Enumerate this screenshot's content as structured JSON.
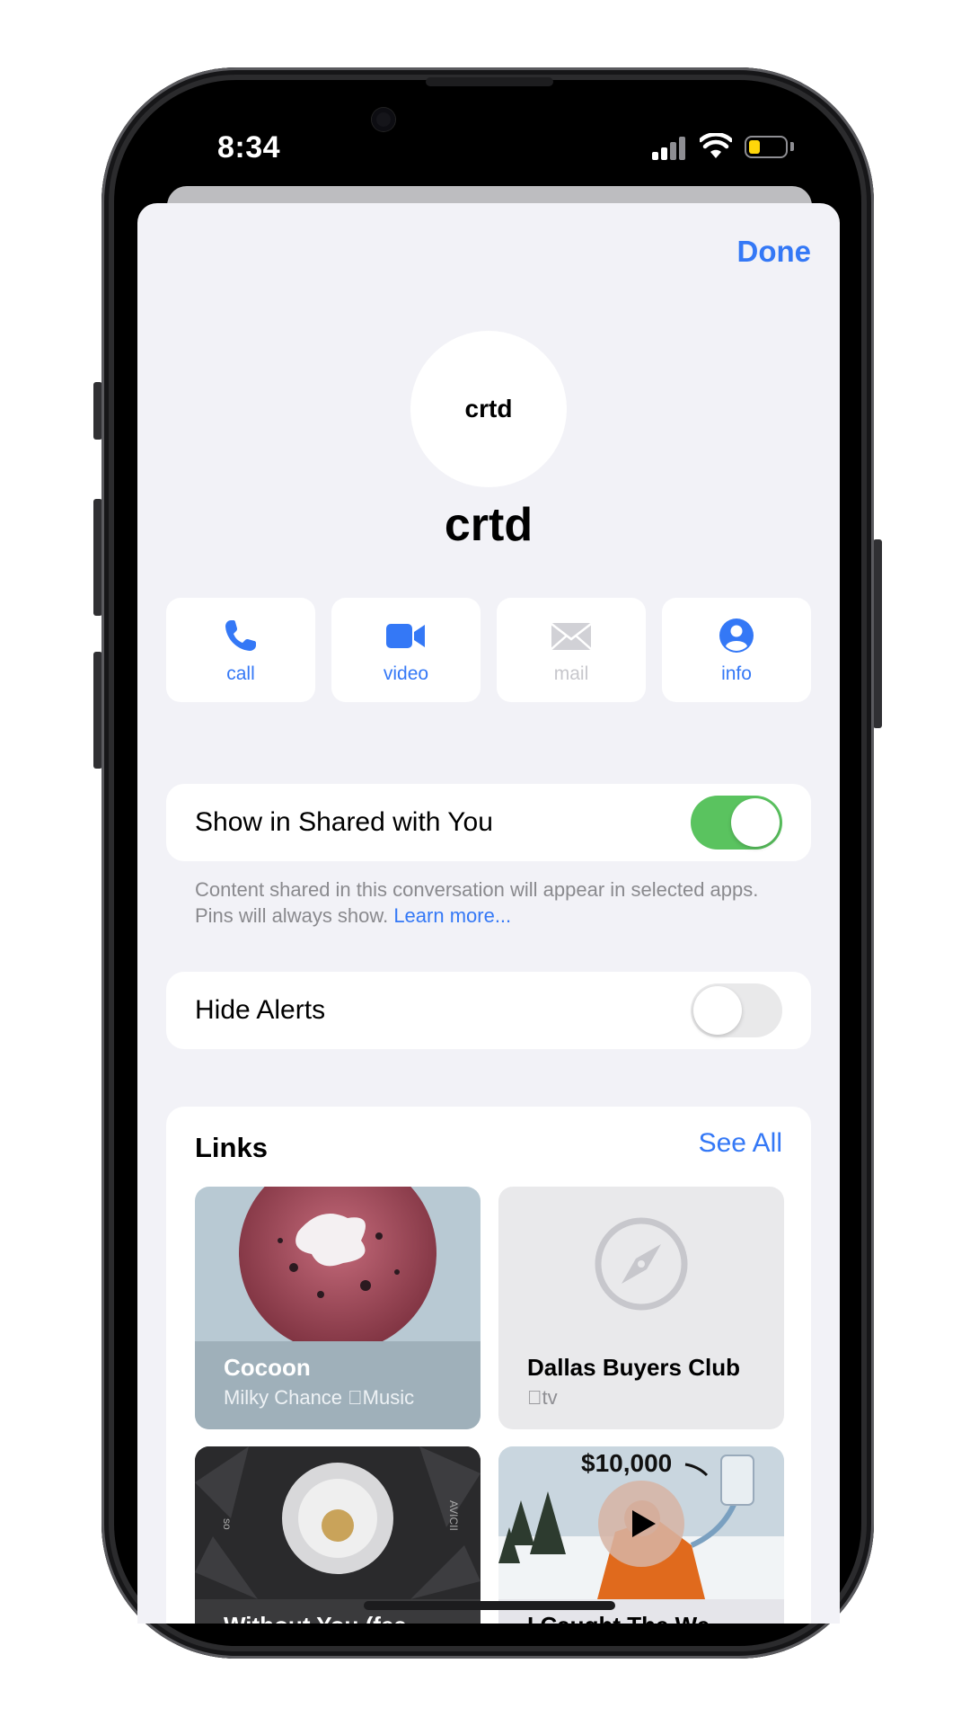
{
  "status_bar": {
    "time": "8:34"
  },
  "header": {
    "done_label": "Done"
  },
  "contact": {
    "avatar_initials": "crtd",
    "name": "crtd"
  },
  "actions": [
    {
      "label": "call",
      "icon": "phone-icon",
      "enabled": true
    },
    {
      "label": "video",
      "icon": "video-camera-icon",
      "enabled": true
    },
    {
      "label": "mail",
      "icon": "envelope-icon",
      "enabled": false
    },
    {
      "label": "info",
      "icon": "person-circle-icon",
      "enabled": true
    }
  ],
  "shared_with_you": {
    "label": "Show in Shared with You",
    "on": true,
    "footnote": "Content shared in this conversation will appear in selected apps. Pins will always show.",
    "learn_more": "Learn more..."
  },
  "hide_alerts": {
    "label": "Hide Alerts",
    "on": false
  },
  "links": {
    "title": "Links",
    "see_all": "See All",
    "items": [
      {
        "title": "Cocoon",
        "artist": "Milky Chance",
        "service": "Music"
      },
      {
        "title": "Dallas Buyers Club",
        "service": "tv"
      },
      {
        "title": "Without You (fea",
        "cover_text_left": "so",
        "cover_text_right": "AVICII"
      },
      {
        "title": "I Caught The We",
        "overlay_text": "$10,000"
      }
    ]
  },
  "colors": {
    "accent": "#3478f6",
    "toggle_on": "#5ac35f",
    "sheet_bg": "#f2f2f7"
  }
}
